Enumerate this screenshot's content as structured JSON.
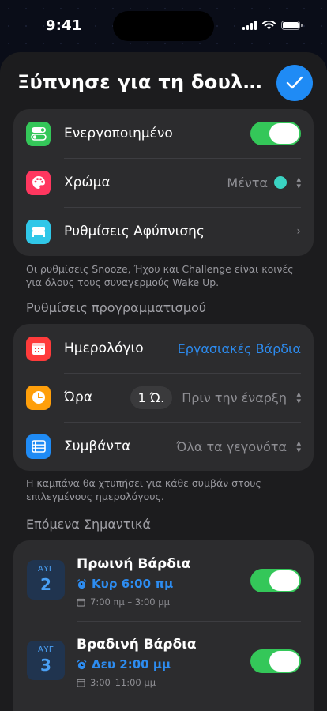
{
  "status_bar": {
    "time": "9:41"
  },
  "sheet": {
    "title": "Ξύπνησε για τη δουλειά"
  },
  "main_settings": {
    "enabled_label": "Ενεργοποιημένο",
    "color_label": "Χρώμα",
    "color_value": "Μέντα",
    "color_swatch": "#3ad3c2",
    "wake_settings_label": "Ρυθμίσεις Αφύπνισης"
  },
  "main_note": "Οι ρυθμίσεις Snooze, Ήχου και Challenge είναι κοινές για όλους τους συναγερμούς Wake Up.",
  "schedule": {
    "header": "Ρυθμίσεις προγραμματισμού",
    "calendar_label": "Ημερολόγιο",
    "calendar_value": "Εργασιακές Βάρδια",
    "time_label": "Ώρα",
    "time_offset": "1 Ώ.",
    "time_value": "Πριν την έναρξη",
    "events_label": "Συμβάντα",
    "events_value": "Όλα τα γεγονότα"
  },
  "schedule_note": "Η καμπάνα θα χτυπήσει για κάθε συμβάν στους επιλεγμένους ημερολόγους.",
  "upcoming": {
    "header": "Επόμενα Σημαντικά",
    "events": [
      {
        "month": "ΑΥΓ",
        "day": "2",
        "title": "Πρωινή Βάρδια",
        "alarm": "Κυρ 6:00 πμ",
        "range": "7:00 πμ – 3:00 μμ",
        "enabled": true
      },
      {
        "month": "ΑΥΓ",
        "day": "3",
        "title": "Βραδινή Βάρδια",
        "alarm": "Δευ 2:00 μμ",
        "range": "3:00–11:00 μμ",
        "enabled": true
      }
    ]
  }
}
